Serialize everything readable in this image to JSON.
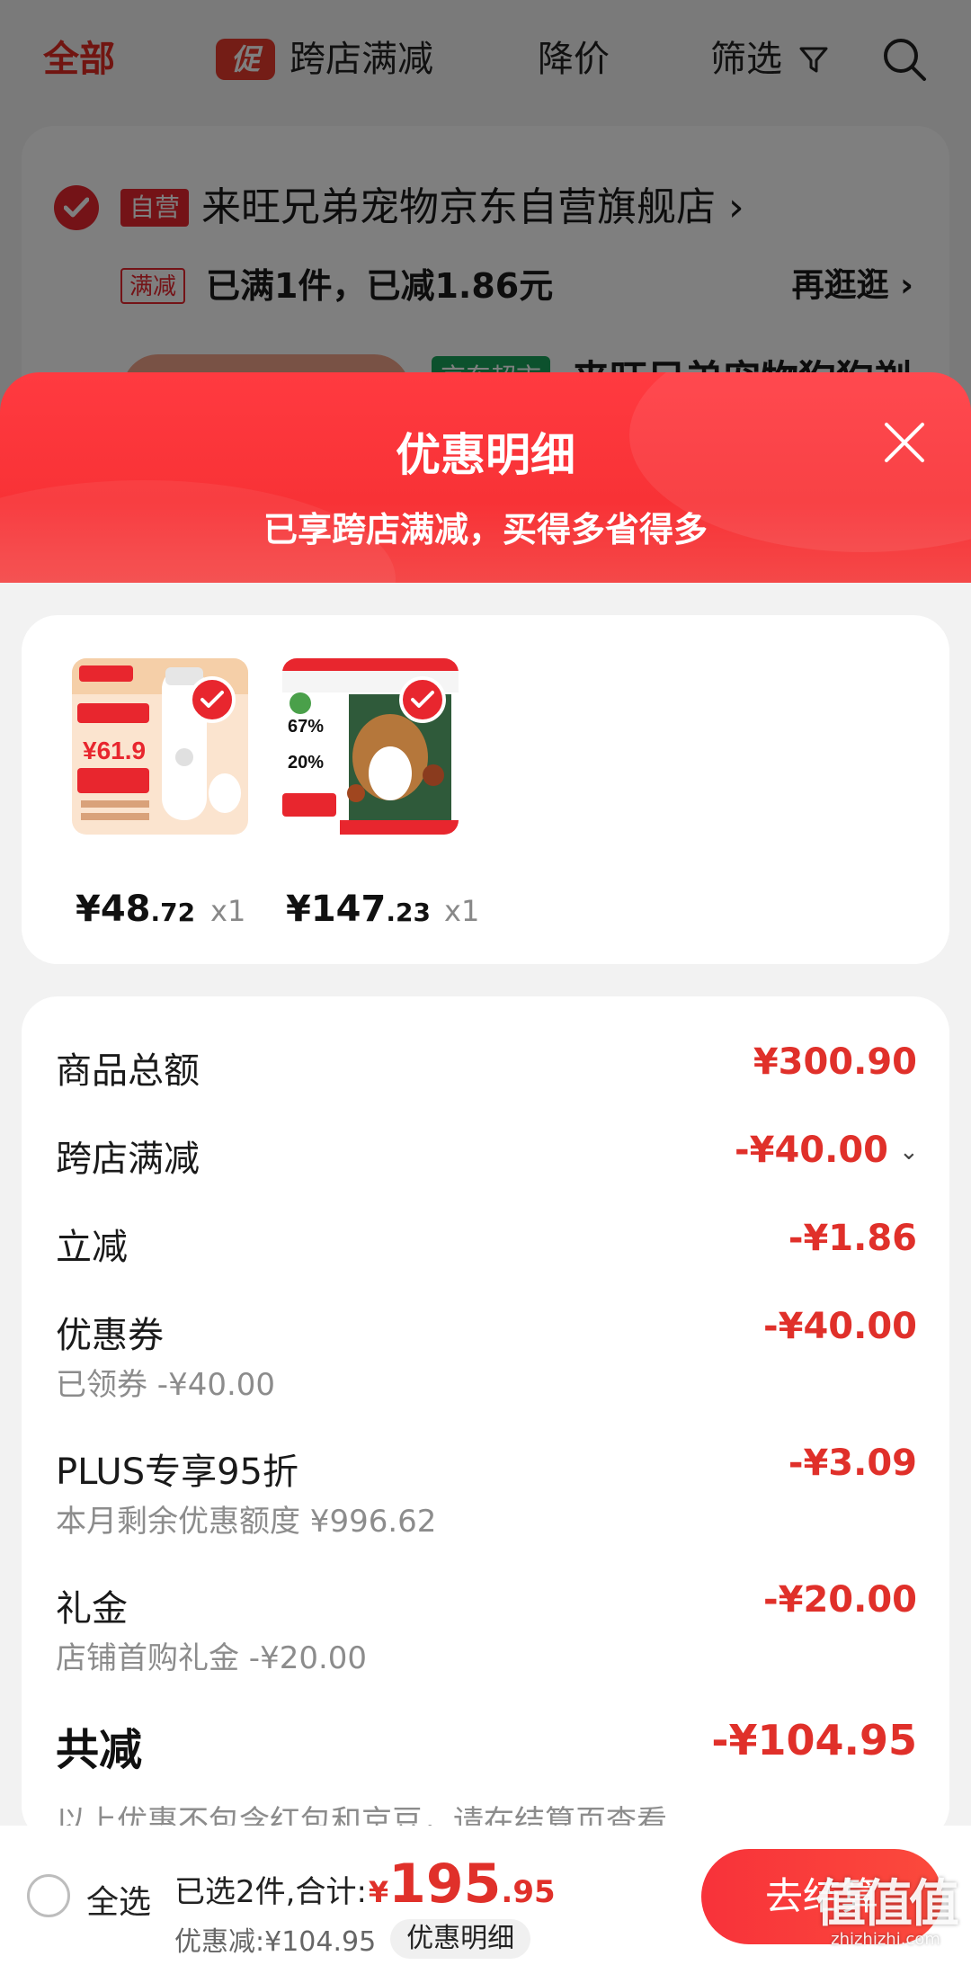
{
  "background": {
    "tabs": {
      "all": "全部",
      "promo_badge": "促",
      "promo": "跨店满减",
      "price_drop": "降价",
      "filter": "筛选"
    },
    "store": {
      "self_badge": "自营",
      "name": "来旺兄弟宠物京东自营旗舰店 ›",
      "promo_badge": "满减",
      "promo_text": "已满1件，已减1.86元",
      "browse": "再逛逛 ›",
      "super_badge": "京东超市",
      "product_title": "来旺兄弟宠物狗狗剃"
    }
  },
  "sheet": {
    "title": "优惠明细",
    "subtitle": "已享跨店满减，买得多省得多",
    "items": [
      {
        "price_int": "¥48",
        "price_dec": ".72",
        "qty": "x1",
        "image": "pet-clipper-product-image"
      },
      {
        "price_int": "¥147",
        "price_dec": ".23",
        "qty": "x1",
        "image": "dog-food-product-image"
      }
    ],
    "rows": [
      {
        "label": "商品总额",
        "value": "¥300.90",
        "sub": ""
      },
      {
        "label": "跨店满减",
        "value": "-¥40.00",
        "sub": ""
      },
      {
        "label": "立减",
        "value": "-¥1.86",
        "sub": ""
      },
      {
        "label": "优惠券",
        "value": "-¥40.00",
        "sub": "已领券 -¥40.00"
      },
      {
        "label": "PLUS专享95折",
        "value": "-¥3.09",
        "sub": "本月剩余优惠额度 ¥996.62"
      },
      {
        "label": "礼金",
        "value": "-¥20.00",
        "sub": "店铺首购礼金 -¥20.00"
      }
    ],
    "total": {
      "label": "共减",
      "value": "-¥104.95",
      "note": "以上优惠不包含红包和京豆，请在结算页查看"
    }
  },
  "bottom": {
    "select_all": "全选",
    "selected_text": "已选2件,合计:",
    "yen": "¥",
    "total_int": "195",
    "total_dec": ".95",
    "discount_text": "优惠减:¥104.95",
    "detail_pill": "优惠明细",
    "checkout": "去结算"
  },
  "watermark": {
    "text": "值值值",
    "sub": "zhizhizhi.com"
  },
  "colors": {
    "accent": "#e8262e",
    "price_red": "#e0302a",
    "check_green": "#19a35a"
  }
}
